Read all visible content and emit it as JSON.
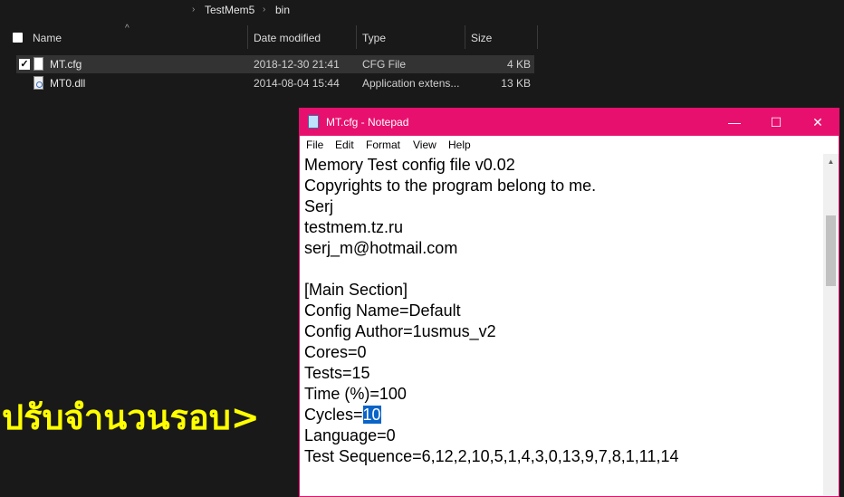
{
  "breadcrumb": [
    "TestMem5",
    "bin"
  ],
  "explorer": {
    "columns": {
      "name": "Name",
      "date": "Date modified",
      "type": "Type",
      "size": "Size"
    },
    "files": [
      {
        "name": "MT.cfg",
        "date": "2018-12-30 21:41",
        "type": "CFG File",
        "size": "4 KB",
        "selected": true
      },
      {
        "name": "MT0.dll",
        "date": "2014-08-04 15:44",
        "type": "Application extens...",
        "size": "13 KB",
        "selected": false
      }
    ]
  },
  "notepad": {
    "title": "MT.cfg - Notepad",
    "window_buttons": {
      "minimize": "—",
      "maximize": "☐",
      "close": "✕"
    },
    "menu": [
      "File",
      "Edit",
      "Format",
      "View",
      "Help"
    ],
    "lines": [
      "Memory Test config file v0.02",
      "Copyrights to the program belong to me.",
      "Serj",
      "testmem.tz.ru",
      "serj_m@hotmail.com",
      "",
      "[Main Section]",
      "Config Name=Default",
      "Config Author=1usmus_v2",
      "Cores=0",
      "Tests=15",
      "Time (%)=100",
      "Cycles=",
      "Language=0",
      "Test Sequence=6,12,2,10,5,1,4,3,0,13,9,7,8,1,11,14"
    ],
    "cycles_value": "10"
  },
  "annotation": "ปรับจำนวนรอบ>",
  "colors": {
    "titlebar": "#e8106e",
    "annotation": "#ffff00",
    "selection": "#0a64c8"
  }
}
